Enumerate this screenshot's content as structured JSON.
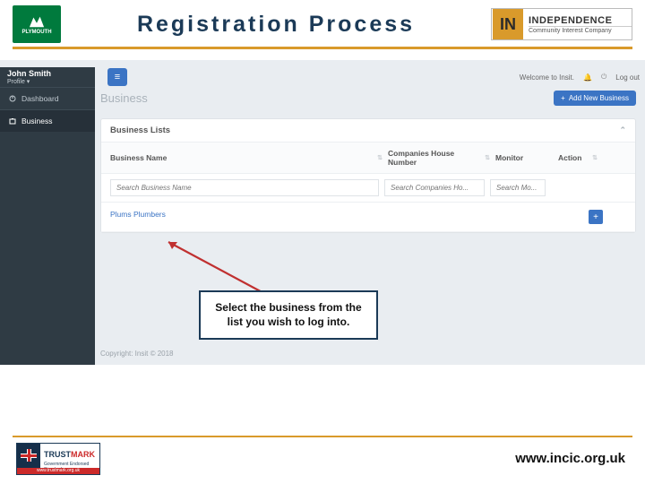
{
  "header": {
    "title": "Registration Process",
    "plymouth_label": "PLYMOUTH",
    "independence_l1": "INDEPENDENCE",
    "independence_l2": "Community Interest Company",
    "in_mark": "IN"
  },
  "app": {
    "user": {
      "name": "John Smith",
      "profile_label": "Profile ▾"
    },
    "welcome_prefix": "Welcome to Insit.",
    "logout_label": "Log out",
    "sidebar": {
      "items": [
        {
          "icon": "dashboard-icon",
          "label": "Dashboard"
        },
        {
          "icon": "business-icon",
          "label": "Business"
        }
      ]
    },
    "breadcrumb": "Business",
    "add_button": "Add New Business",
    "panel_title": "Business Lists",
    "columns": {
      "business_name": "Business Name",
      "companies_house": "Companies House Number",
      "monitor": "Monitor",
      "action": "Action"
    },
    "search": {
      "bn_placeholder": "Search Business Name",
      "ch_placeholder": "Search Companies Ho...",
      "mo_placeholder": "Search Mo..."
    },
    "rows": [
      {
        "name": "Plums Plumbers"
      }
    ],
    "copyright": "Copyright: Insit © 2018"
  },
  "callout": "Select the business from the list you wish to log into.",
  "footer": {
    "trustmark_t1": "TRUST",
    "trustmark_t2": "MARK",
    "trustmark_sub": "Government Endorsed Standards",
    "trustmark_url": "www.trustmark.org.uk",
    "site_url": "www.incic.org.uk"
  }
}
